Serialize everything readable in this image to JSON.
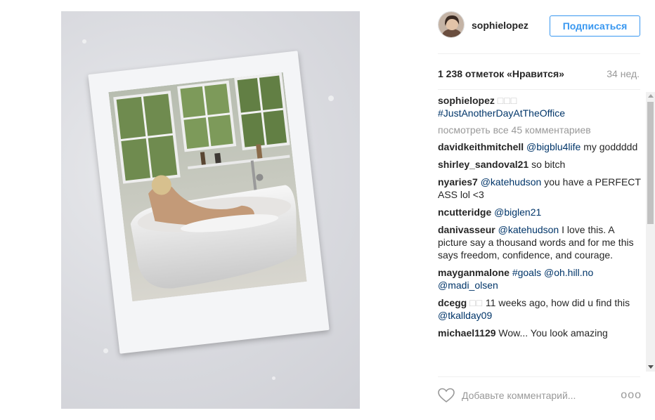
{
  "post": {
    "username": "sophielopez",
    "follow_label": "Подписаться",
    "likes": "1 238 отметок «Нравится»",
    "age": "34 нед."
  },
  "comments": [
    {
      "user": "sophielopez",
      "parts": [
        {
          "type": "glyph",
          "text": "□□□"
        },
        {
          "type": "br"
        },
        {
          "type": "tag",
          "text": "#JustAnotherDayAtTheOffice"
        }
      ]
    },
    {
      "view_all": "посмотреть все 45 комментариев"
    },
    {
      "user": "davidkeithmitchell",
      "parts": [
        {
          "type": "tag",
          "text": "@bigblu4life"
        },
        {
          "type": "text",
          "text": " my goddddd"
        }
      ]
    },
    {
      "user": "shirley_sandoval21",
      "parts": [
        {
          "type": "text",
          "text": "so bitch"
        }
      ]
    },
    {
      "user": "nyaries7",
      "parts": [
        {
          "type": "tag",
          "text": "@katehudson"
        },
        {
          "type": "text",
          "text": " you have a PERFECT ASS lol <3"
        }
      ]
    },
    {
      "user": "ncutteridge",
      "parts": [
        {
          "type": "tag",
          "text": "@biglen21"
        }
      ]
    },
    {
      "user": "danivasseur",
      "parts": [
        {
          "type": "tag",
          "text": "@katehudson"
        },
        {
          "type": "text",
          "text": " I love this. A picture say a thousand words and for me this says freedom, confidence, and courage."
        }
      ]
    },
    {
      "user": "mayganmalone",
      "parts": [
        {
          "type": "tag",
          "text": "#goals"
        },
        {
          "type": "text",
          "text": " "
        },
        {
          "type": "tag",
          "text": "@oh.hill.no"
        },
        {
          "type": "text",
          "text": " "
        },
        {
          "type": "tag",
          "text": "@madi_olsen"
        }
      ]
    },
    {
      "user": "dcegg",
      "parts": [
        {
          "type": "glyph",
          "text": "□□"
        },
        {
          "type": "text",
          "text": " 11 weeks ago, how did u find this "
        },
        {
          "type": "tag",
          "text": "@tkallday09"
        }
      ]
    },
    {
      "user": "michael1129",
      "parts": [
        {
          "type": "text",
          "text": "Wow... You look amazing"
        }
      ]
    }
  ],
  "composer": {
    "placeholder": "Добавьте комментарий...",
    "more": "ooo"
  },
  "icons": {
    "like": "heart-outline-icon",
    "more": "more-options-icon"
  },
  "colors": {
    "follow": "#3897f0",
    "tag": "#003569",
    "muted": "#999999"
  }
}
